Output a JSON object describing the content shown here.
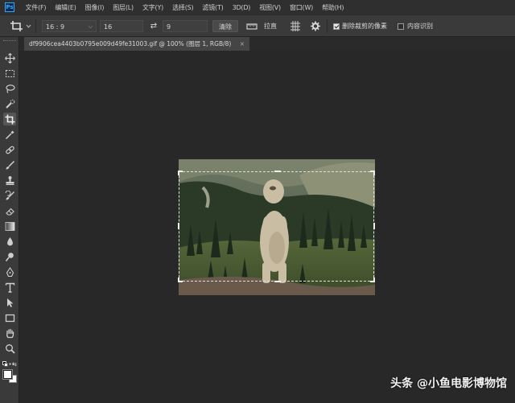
{
  "app": {
    "logo": "Ps"
  },
  "menubar": {
    "items": [
      "文件(F)",
      "编辑(E)",
      "图像(I)",
      "图层(L)",
      "文字(Y)",
      "选择(S)",
      "滤镜(T)",
      "3D(D)",
      "视图(V)",
      "窗口(W)",
      "帮助(H)"
    ]
  },
  "options": {
    "ratio_preset": "16 : 9",
    "width_value": "16",
    "height_value": "9",
    "clear_label": "清除",
    "straighten_label": "拉直",
    "delete_cropped_label": "删除裁剪的像素",
    "delete_cropped_checked": true,
    "content_aware_label": "内容识别",
    "content_aware_checked": false
  },
  "document": {
    "tab_title": "df9906cea4403b0795e009d49fe31003.gif @ 100% (图层 1, RGB/8)",
    "close_glyph": "×"
  },
  "toolbar": {
    "tools": [
      "move",
      "marquee",
      "lasso",
      "quick-select",
      "crop",
      "eyedropper",
      "healing",
      "brush",
      "stamp",
      "history-brush",
      "eraser",
      "gradient",
      "blur",
      "dodge",
      "pen",
      "type",
      "path-select",
      "rectangle",
      "hand",
      "zoom",
      "more"
    ]
  },
  "colors": {
    "foreground": "#ffffff",
    "background": "#ffffff",
    "accent": "#31a8ff"
  },
  "watermark": "头条 @小鱼电影博物馆"
}
